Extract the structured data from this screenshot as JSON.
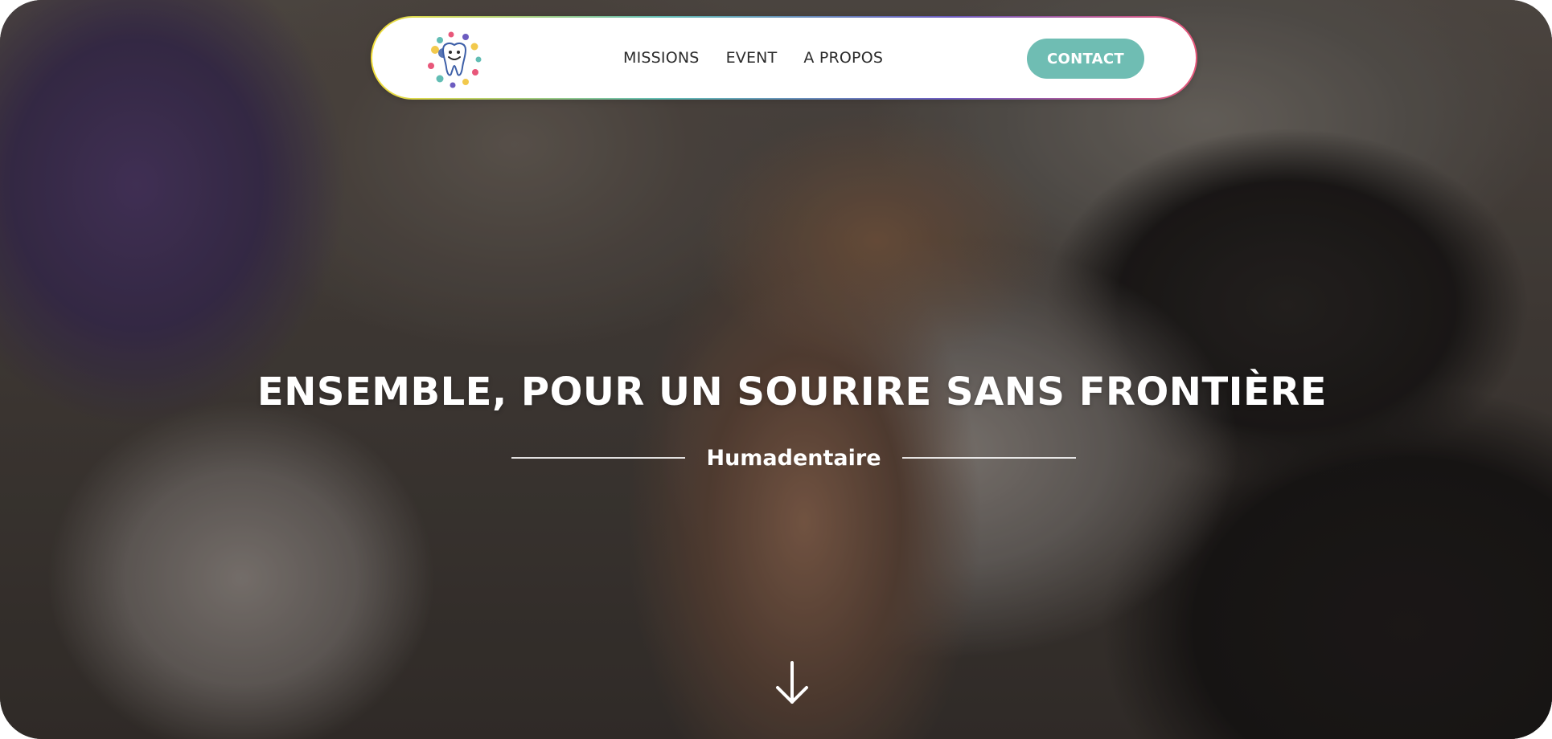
{
  "nav": {
    "logo_icon": "smiling-tooth-logo",
    "links": [
      "MISSIONS",
      "EVENT",
      "A PROPOS"
    ],
    "contact_label": "CONTACT"
  },
  "hero": {
    "title": "ENSEMBLE, POUR UN SOURIRE SANS FRONTIÈRE",
    "subtitle": "Humadentaire",
    "scroll_icon": "arrow-down-icon"
  },
  "colors": {
    "accent": "#6fbdb3",
    "nav_text": "#2b2b2b",
    "hero_text": "#ffffff"
  }
}
